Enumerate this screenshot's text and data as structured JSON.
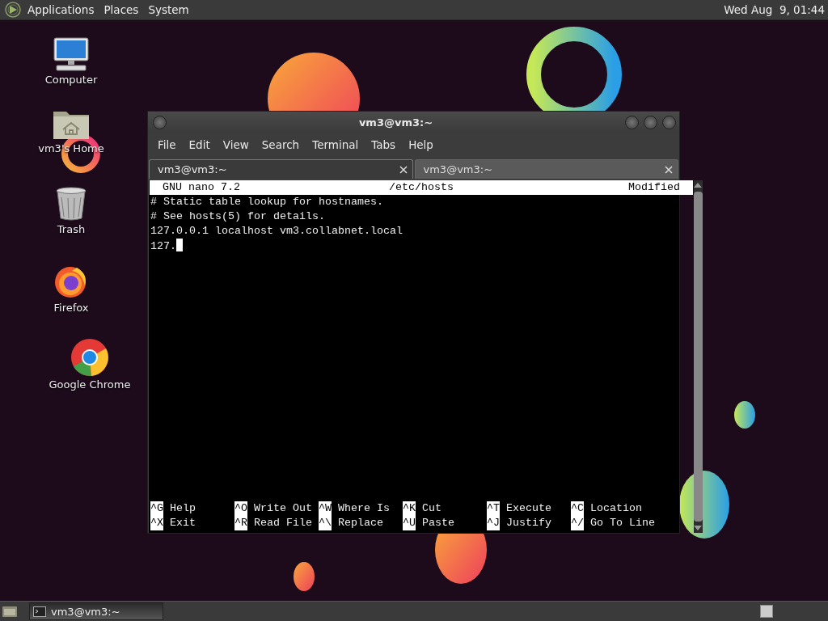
{
  "top_panel": {
    "menus": [
      "Applications",
      "Places",
      "System"
    ],
    "clock": "Wed Aug  9, 01:44"
  },
  "desktop_icons": [
    {
      "label": "Computer",
      "kind": "computer"
    },
    {
      "label": "vm3's Home",
      "kind": "home"
    },
    {
      "label": "Trash",
      "kind": "trash"
    },
    {
      "label": "Firefox",
      "kind": "firefox"
    },
    {
      "label": "Google Chrome",
      "kind": "chrome"
    }
  ],
  "window": {
    "title": "vm3@vm3:~",
    "menu": [
      "File",
      "Edit",
      "View",
      "Search",
      "Terminal",
      "Tabs",
      "Help"
    ],
    "tabs": [
      {
        "label": "vm3@vm3:~",
        "selected": true
      },
      {
        "label": "vm3@vm3:~",
        "selected": false
      }
    ],
    "nano": {
      "header": {
        "version": "GNU nano 7.2",
        "file": "/etc/hosts",
        "status": "Modified"
      },
      "lines": [
        "# Static table lookup for hostnames.",
        "# See hosts(5) for details.",
        "127.0.0.1 localhost vm3.collabnet.local",
        "127."
      ],
      "shortcuts": [
        {
          "key": "^G",
          "label": "Help"
        },
        {
          "key": "^O",
          "label": "Write Out"
        },
        {
          "key": "^W",
          "label": "Where Is"
        },
        {
          "key": "^K",
          "label": "Cut"
        },
        {
          "key": "^T",
          "label": "Execute"
        },
        {
          "key": "^C",
          "label": "Location"
        },
        {
          "key": "^X",
          "label": "Exit"
        },
        {
          "key": "^R",
          "label": "Read File"
        },
        {
          "key": "^\\",
          "label": "Replace"
        },
        {
          "key": "^U",
          "label": "Paste"
        },
        {
          "key": "^J",
          "label": "Justify"
        },
        {
          "key": "^/",
          "label": "Go To Line"
        }
      ]
    }
  },
  "taskbar": {
    "tasks": [
      {
        "label": "vm3@vm3:~"
      }
    ]
  }
}
